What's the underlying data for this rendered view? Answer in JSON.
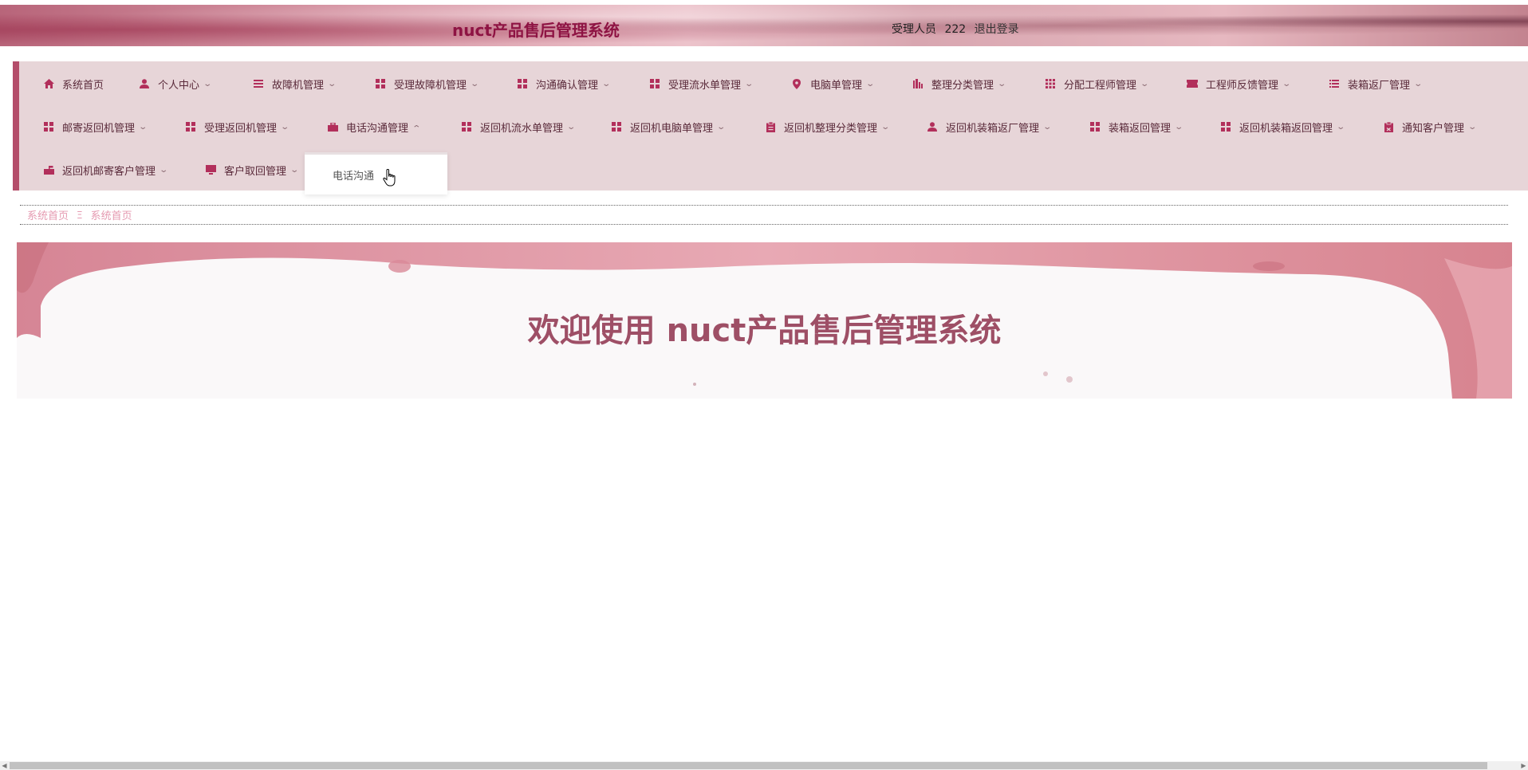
{
  "header": {
    "title": "nuct产品售后管理系统",
    "user_role": "受理人员",
    "user_name": "222",
    "logout": "退出登录"
  },
  "nav": {
    "row1": [
      {
        "label": "系统首页",
        "icon": "home-icon",
        "dropdown": false
      },
      {
        "label": "个人中心",
        "icon": "user-icon",
        "dropdown": true
      },
      {
        "label": "故障机管理",
        "icon": "list-icon",
        "dropdown": true
      },
      {
        "label": "受理故障机管理",
        "icon": "grid-icon",
        "dropdown": true
      },
      {
        "label": "沟通确认管理",
        "icon": "grid-icon",
        "dropdown": true
      },
      {
        "label": "受理流水单管理",
        "icon": "grid-icon",
        "dropdown": true
      },
      {
        "label": "电脑单管理",
        "icon": "location-pin-icon",
        "dropdown": true
      },
      {
        "label": "整理分类管理",
        "icon": "bar-chart-icon",
        "dropdown": true
      },
      {
        "label": "分配工程师管理",
        "icon": "apps-icon",
        "dropdown": true
      },
      {
        "label": "工程师反馈管理",
        "icon": "ticket-icon",
        "dropdown": true
      },
      {
        "label": "装箱返厂管理",
        "icon": "list-ordered-icon",
        "dropdown": true
      }
    ],
    "row2": [
      {
        "label": "邮寄返回机管理",
        "icon": "grid-icon",
        "dropdown": true
      },
      {
        "label": "受理返回机管理",
        "icon": "grid-icon",
        "dropdown": true
      },
      {
        "label": "电话沟通管理",
        "icon": "briefcase-icon",
        "dropdown": true,
        "open": true
      },
      {
        "label": "返回机流水单管理",
        "icon": "grid-icon",
        "dropdown": true
      },
      {
        "label": "返回机电脑单管理",
        "icon": "grid-icon",
        "dropdown": true
      },
      {
        "label": "返回机整理分类管理",
        "icon": "clipboard-icon",
        "dropdown": true
      },
      {
        "label": "返回机装箱返厂管理",
        "icon": "user-icon",
        "dropdown": true
      },
      {
        "label": "装箱返回管理",
        "icon": "grid-icon",
        "dropdown": true
      },
      {
        "label": "返回机装箱返回管理",
        "icon": "grid-icon",
        "dropdown": true
      },
      {
        "label": "通知客户管理",
        "icon": "clipboard-check-icon",
        "dropdown": true
      }
    ],
    "row3": [
      {
        "label": "返回机邮寄客户管理",
        "icon": "mailbox-icon",
        "dropdown": true
      },
      {
        "label": "客户取回管理",
        "icon": "monitor-icon",
        "dropdown": true
      }
    ]
  },
  "dropdown": {
    "items": [
      "电话沟通"
    ]
  },
  "breadcrumb": {
    "items": [
      "系统首页",
      "系统首页"
    ],
    "separator": "Ξ"
  },
  "banner": {
    "title": "欢迎使用 nuct产品售后管理系统"
  },
  "colors": {
    "accent": "#b22f5b",
    "title": "#8e1343",
    "nav_bg": "#e7d5d8",
    "banner_text": "#9e4f66",
    "breadcrumb": "#e59ab1"
  }
}
